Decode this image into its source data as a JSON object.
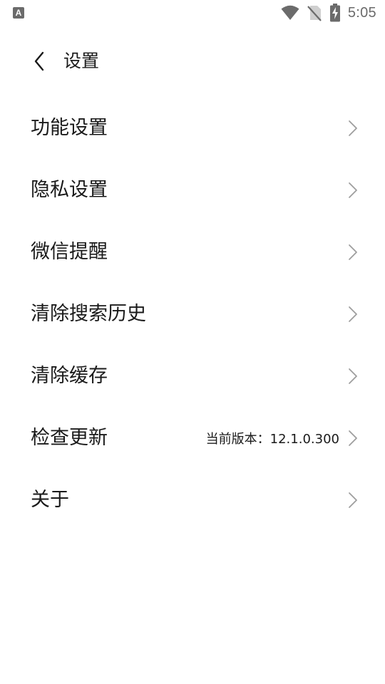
{
  "status_bar": {
    "app_icon_letter": "A",
    "time": "5:05",
    "icons": [
      "wifi-icon",
      "no-sim-icon",
      "battery-charging-icon"
    ]
  },
  "header": {
    "back_icon": "chevron-left-icon",
    "title": "设置"
  },
  "settings": {
    "items": [
      {
        "label": "功能设置",
        "value": ""
      },
      {
        "label": "隐私设置",
        "value": ""
      },
      {
        "label": "微信提醒",
        "value": ""
      },
      {
        "label": "清除搜索历史",
        "value": ""
      },
      {
        "label": "清除缓存",
        "value": ""
      },
      {
        "label": "检查更新",
        "value": "当前版本：12.1.0.300"
      },
      {
        "label": "关于",
        "value": ""
      }
    ],
    "row_icon": "chevron-right-icon"
  },
  "colors": {
    "background": "#ffffff",
    "text_primary": "#1a1a1a",
    "status_icons": "#6b6b6b",
    "chevron": "#9e9e9e"
  }
}
